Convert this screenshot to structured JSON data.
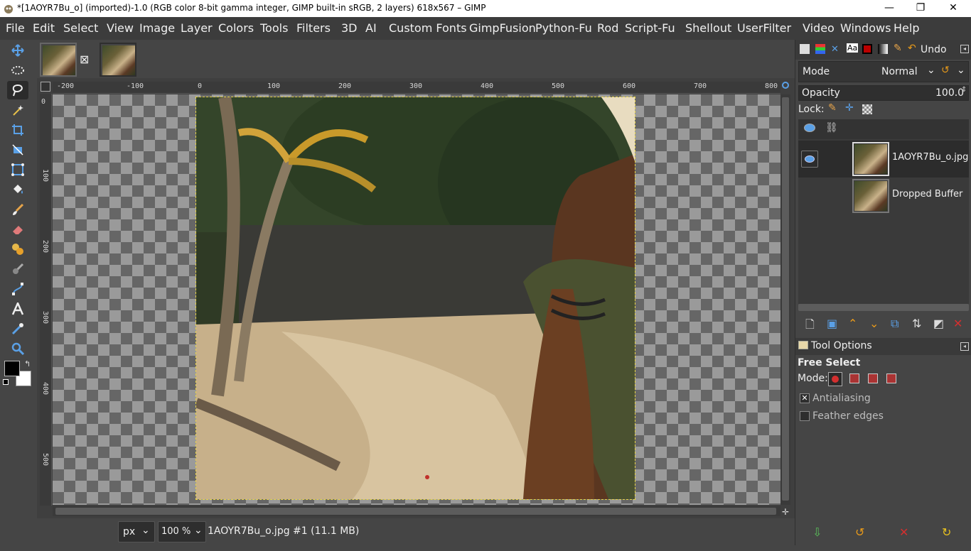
{
  "window": {
    "title": "*[1AOYR7Bu_o] (imported)-1.0 (RGB color 8-bit gamma integer, GIMP built-in sRGB, 2 layers) 618x567 – GIMP",
    "minimize": "—",
    "restore": "❐",
    "close": "✕"
  },
  "menu": [
    "File",
    "Edit",
    "Select",
    "View",
    "Image",
    "Layer",
    "Colors",
    "Tools",
    "Filters",
    "3D",
    "AI",
    "Custom Fonts",
    "GimpFusion",
    "Python-Fu",
    "Rod",
    "Script-Fu",
    "Shellout",
    "UserFilter",
    "Video",
    "Windows",
    "Help"
  ],
  "tools": [
    {
      "name": "move-tool-icon"
    },
    {
      "name": "ellipse-select-icon"
    },
    {
      "name": "free-select-icon",
      "active": true
    },
    {
      "name": "fuzzy-select-icon"
    },
    {
      "name": "crop-icon"
    },
    {
      "name": "unified-transform-icon"
    },
    {
      "name": "cage-transform-icon"
    },
    {
      "name": "bucket-fill-icon"
    },
    {
      "name": "paintbrush-icon"
    },
    {
      "name": "eraser-icon"
    },
    {
      "name": "clone-icon"
    },
    {
      "name": "smudge-icon"
    },
    {
      "name": "paths-icon"
    },
    {
      "name": "text-icon"
    },
    {
      "name": "color-picker-icon"
    },
    {
      "name": "zoom-icon"
    }
  ],
  "tabs": {
    "close_glyph": "⊠"
  },
  "rulers": {
    "h_labels": [
      "-200",
      "-100",
      "0",
      "100",
      "200",
      "300",
      "400",
      "500",
      "600",
      "700",
      "800"
    ],
    "v_labels": [
      "0",
      "100",
      "200",
      "300",
      "400",
      "500"
    ]
  },
  "status": {
    "unit": "px",
    "zoom": "100 %",
    "info": "1AOYR7Bu_o.jpg #1 (11.1 MB)"
  },
  "panel": {
    "undo_tab": "Undo",
    "mode_label": "Mode",
    "mode_value": "Normal",
    "opacity_label": "Opacity",
    "opacity_value": "100.0",
    "lock_label": "Lock:",
    "layers": [
      {
        "name": "1AOYR7Bu_o.jpg",
        "visible": true,
        "selected": true
      },
      {
        "name": "Dropped Buffer",
        "visible": false,
        "selected": false
      }
    ]
  },
  "tool_options": {
    "tab_title": "Tool Options",
    "tool_name": "Free Select",
    "mode_label": "Mode:",
    "antialiasing_label": "Antialiasing",
    "antialiasing_checked": true,
    "feather_label": "Feather edges",
    "feather_checked": false
  },
  "colors": {
    "fg": "#000000",
    "bg": "#ffffff",
    "selection_outline": "#e6d34a",
    "accent_orange": "#e89a1a",
    "accent_red": "#d32f2f"
  }
}
